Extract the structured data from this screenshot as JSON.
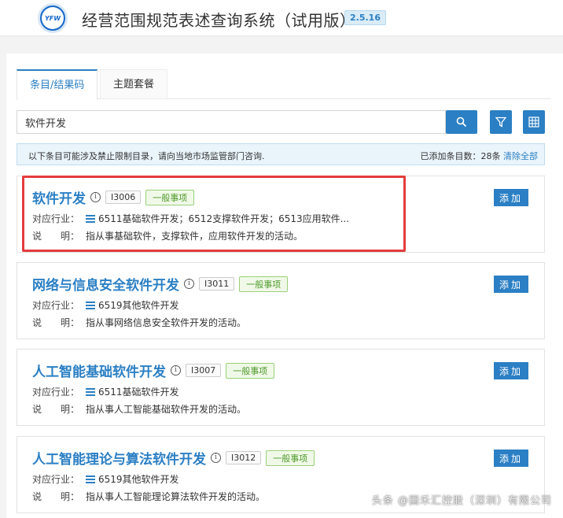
{
  "header": {
    "logo_text": "YFW",
    "title": "经营范围规范表述查询系统（试用版）",
    "version": "2.5.16"
  },
  "tabs": [
    {
      "label": "条目/结果码",
      "active": true
    },
    {
      "label": "主题套餐",
      "active": false
    }
  ],
  "search": {
    "value": "软件开发",
    "search_icon": "search-icon",
    "filter_icon": "filter-icon",
    "grid_icon": "grid-icon"
  },
  "notice": {
    "text": "以下条目可能涉及禁止限制目录，请向当地市场监管部门咨询.",
    "count_text": "已添加条目数：28条",
    "clear_label": "清除全部"
  },
  "labels": {
    "industry": "对应行业：",
    "description": "说　　明："
  },
  "results": [
    {
      "title": "软件开发",
      "code": "I3006",
      "type": "一般事项",
      "industry": "6511基础软件开发；6512支撑软件开发；6513应用软件...",
      "description": "指从事基础软件，支撑软件，应用软件开发的活动。",
      "add_label": "添加",
      "highlighted": true
    },
    {
      "title": "网络与信息安全软件开发",
      "code": "I3011",
      "type": "一般事项",
      "industry": "6519其他软件开发",
      "description": "指从事网络信息安全软件开发的活动。",
      "add_label": "添加",
      "highlighted": false
    },
    {
      "title": "人工智能基础软件开发",
      "code": "I3007",
      "type": "一般事项",
      "industry": "6511基础软件开发",
      "description": "指从事人工智能基础软件开发的活动。",
      "add_label": "添加",
      "highlighted": false
    },
    {
      "title": "人工智能理论与算法软件开发",
      "code": "I3012",
      "type": "一般事项",
      "industry": "6519其他软件开发",
      "description": "指从事人工智能理论算法软件开发的活动。",
      "add_label": "添加",
      "highlighted": false
    }
  ],
  "watermark": "头条 @国禾汇控股（深圳）有限公司",
  "colors": {
    "accent": "#2b7fc4",
    "highlight_border": "#e43c3c",
    "tag_green": "#4e9a2a"
  }
}
